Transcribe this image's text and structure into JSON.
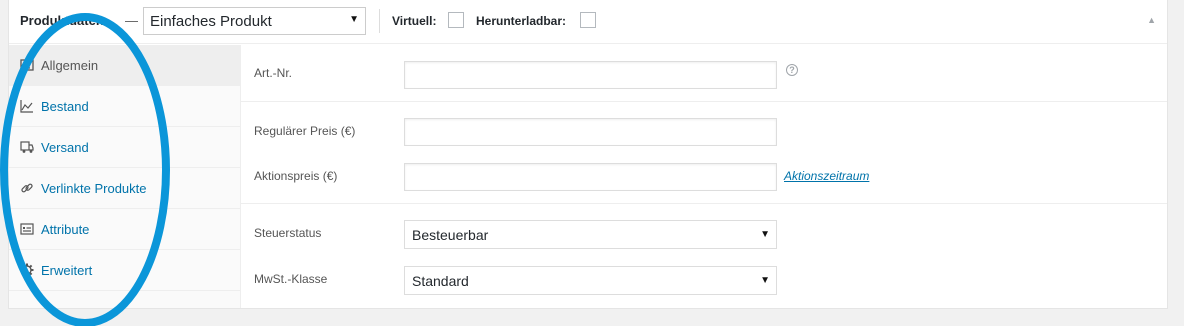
{
  "header": {
    "title": "Produktdaten",
    "separator": "—",
    "product_type": {
      "selected": "Einfaches Produkt",
      "caret": "▼"
    },
    "virtual": {
      "label": "Virtuell:",
      "checked": false
    },
    "downloadable": {
      "label": "Herunterladbar:",
      "checked": false
    },
    "toggle_icon": "▲"
  },
  "tabs": [
    {
      "label": "Allgemein",
      "icon": "general-icon",
      "active": true
    },
    {
      "label": "Bestand",
      "icon": "inventory-chart-icon",
      "active": false
    },
    {
      "label": "Versand",
      "icon": "truck-icon",
      "active": false
    },
    {
      "label": "Verlinkte Produkte",
      "icon": "link-icon",
      "active": false
    },
    {
      "label": "Attribute",
      "icon": "list-icon",
      "active": false
    },
    {
      "label": "Erweitert",
      "icon": "gear-icon",
      "active": false
    }
  ],
  "fields": {
    "sku": {
      "label": "Art.-Nr.",
      "value": "",
      "help": "?"
    },
    "regular_price": {
      "label": "Regulärer Preis (€)",
      "value": ""
    },
    "sale_price": {
      "label": "Aktionspreis (€)",
      "value": "",
      "schedule_link": "Aktionszeitraum"
    },
    "tax_status": {
      "label": "Steuerstatus",
      "selected": "Besteuerbar",
      "caret": "▼"
    },
    "tax_class": {
      "label": "MwSt.-Klasse",
      "selected": "Standard",
      "caret": "▼"
    }
  },
  "colors": {
    "link": "#0073aa",
    "annotation_ellipse": "#0b96d9",
    "active_tab_bg": "#eeeeee"
  }
}
